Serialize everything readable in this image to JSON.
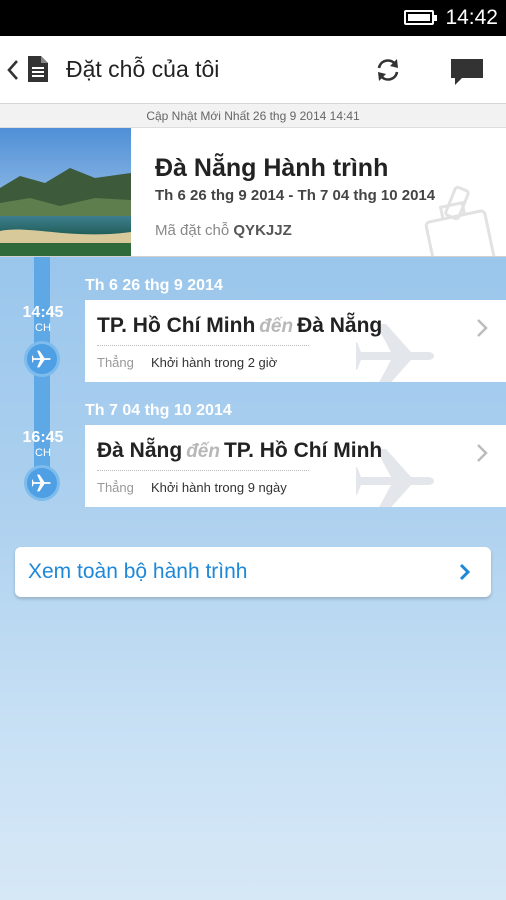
{
  "status_bar": {
    "time": "14:42",
    "battery_icon": "battery-icon"
  },
  "action_bar": {
    "title": "Đặt chỗ của tôi",
    "icons": [
      "back-icon",
      "document-icon",
      "refresh-icon",
      "chat-icon"
    ]
  },
  "update_text": "Cập Nhật Mới Nhất 26 thg 9 2014 14:41",
  "trip": {
    "title": "Đà Nẵng Hành trình",
    "dates": "Th 6 26 thg 9 2014 - Th 7 04 thg 10 2014",
    "code_label": "Mã đặt chỗ",
    "code_value": "QYKJJZ"
  },
  "flights": [
    {
      "date": "Th 6 26 thg 9 2014",
      "time": "14:45",
      "ampm": "CH",
      "origin": "TP. Hồ Chí Minh",
      "connector": "đến",
      "destination": "Đà Nẵng",
      "stops": "Thẳng",
      "departs": "Khởi hành trong 2 giờ"
    },
    {
      "date": "Th 7 04 thg 10 2014",
      "time": "16:45",
      "ampm": "CH",
      "origin": "Đà Nẵng",
      "connector": "đến",
      "destination": "TP. Hồ Chí Minh",
      "stops": "Thẳng",
      "departs": "Khởi hành trong 9 ngày"
    }
  ],
  "view_all": {
    "label": "Xem toàn bộ hành trình"
  },
  "colors": {
    "accent": "#1e88d8",
    "timeline_rail": "#5ea8e6",
    "timeline_bg": "#9ac6ec",
    "status_bar": "#000000"
  }
}
